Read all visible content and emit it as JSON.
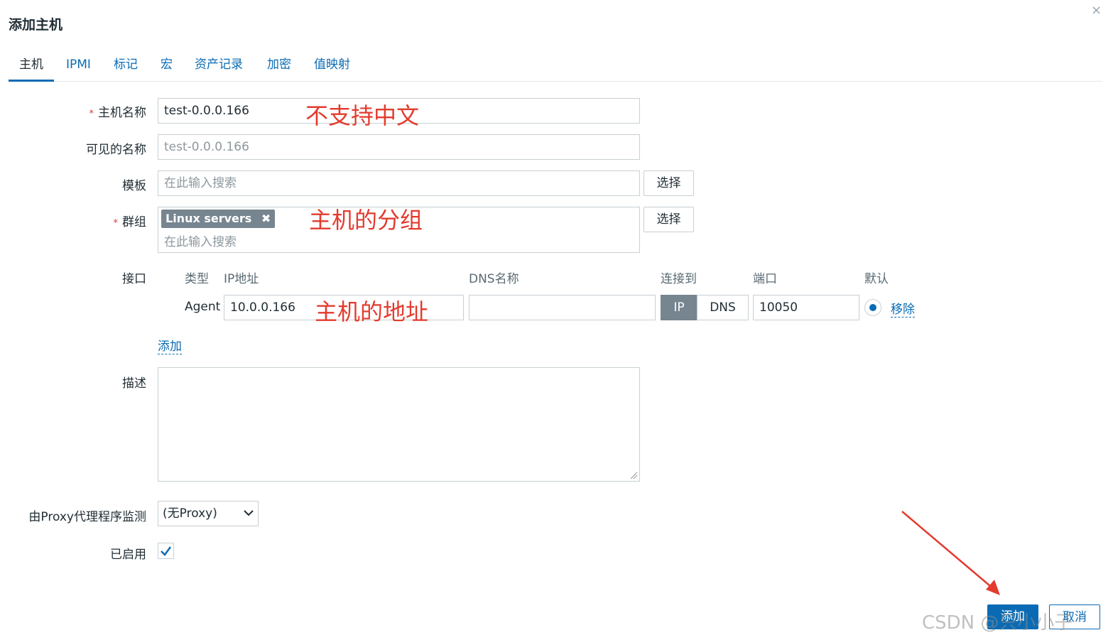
{
  "dialog": {
    "title": "添加主机",
    "close_glyph": "×"
  },
  "tabs": [
    {
      "label": "主机",
      "active": true
    },
    {
      "label": "IPMI"
    },
    {
      "label": "标记"
    },
    {
      "label": "宏"
    },
    {
      "label": "资产记录"
    },
    {
      "label": "加密"
    },
    {
      "label": "值映射"
    }
  ],
  "form": {
    "host_name": {
      "label": "主机名称",
      "required_mark": "*",
      "value": "test-0.0.0.166"
    },
    "visible_name": {
      "label": "可见的名称",
      "placeholder": "test-0.0.0.166"
    },
    "templates": {
      "label": "模板",
      "placeholder": "在此输入搜索",
      "select_label": "选择"
    },
    "groups": {
      "label": "群组",
      "required_mark": "*",
      "tag": "Linux servers",
      "tag_remove_glyph": "✖",
      "placeholder": "在此输入搜索",
      "select_label": "选择"
    },
    "interfaces": {
      "label": "接口",
      "headers": {
        "type": "类型",
        "ip": "IP地址",
        "dns": "DNS名称",
        "connect": "连接到",
        "port": "端口",
        "default": "默认"
      },
      "row": {
        "type": "Agent",
        "ip": "10.0.0.166",
        "dns": "",
        "connect_ip": "IP",
        "connect_dns": "DNS",
        "connect_selected": "IP",
        "port": "10050",
        "remove_label": "移除"
      },
      "add_label": "添加"
    },
    "description": {
      "label": "描述",
      "value": ""
    },
    "proxy": {
      "label": "由Proxy代理程序监测",
      "selected": "(无Proxy)"
    },
    "enabled": {
      "label": "已启用",
      "checked": true
    }
  },
  "annotations": {
    "hostname_note": "不支持中文",
    "group_note": "主机的分组",
    "ip_note": "主机的地址"
  },
  "footer": {
    "add_label": "添加",
    "cancel_label": "取消"
  },
  "watermark": "CSDN @只小小子",
  "colors": {
    "accent": "#0a6bb4",
    "annotation": "#e33b2e",
    "tag_bg": "#76858f"
  }
}
